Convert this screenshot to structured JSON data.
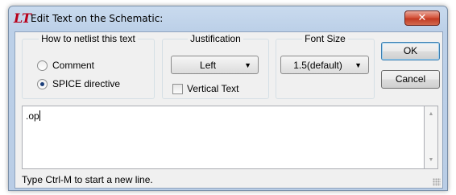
{
  "window": {
    "title": "Edit Text on the Schematic:",
    "app_icon": "ltspice-logo-icon",
    "close_label": "✕"
  },
  "netlist_group": {
    "label": "How to netlist this text",
    "options": [
      {
        "label": "Comment",
        "checked": false
      },
      {
        "label": "SPICE directive",
        "checked": true
      }
    ]
  },
  "justification_group": {
    "label": "Justification",
    "selected": "Left",
    "vertical_text_label": "Vertical Text",
    "vertical_text_checked": false
  },
  "font_size_group": {
    "label": "Font Size",
    "selected": "1.5(default)"
  },
  "buttons": {
    "ok": "OK",
    "cancel": "Cancel"
  },
  "text_area": {
    "value": ".op"
  },
  "hint": "Type Ctrl-M to start a new line."
}
